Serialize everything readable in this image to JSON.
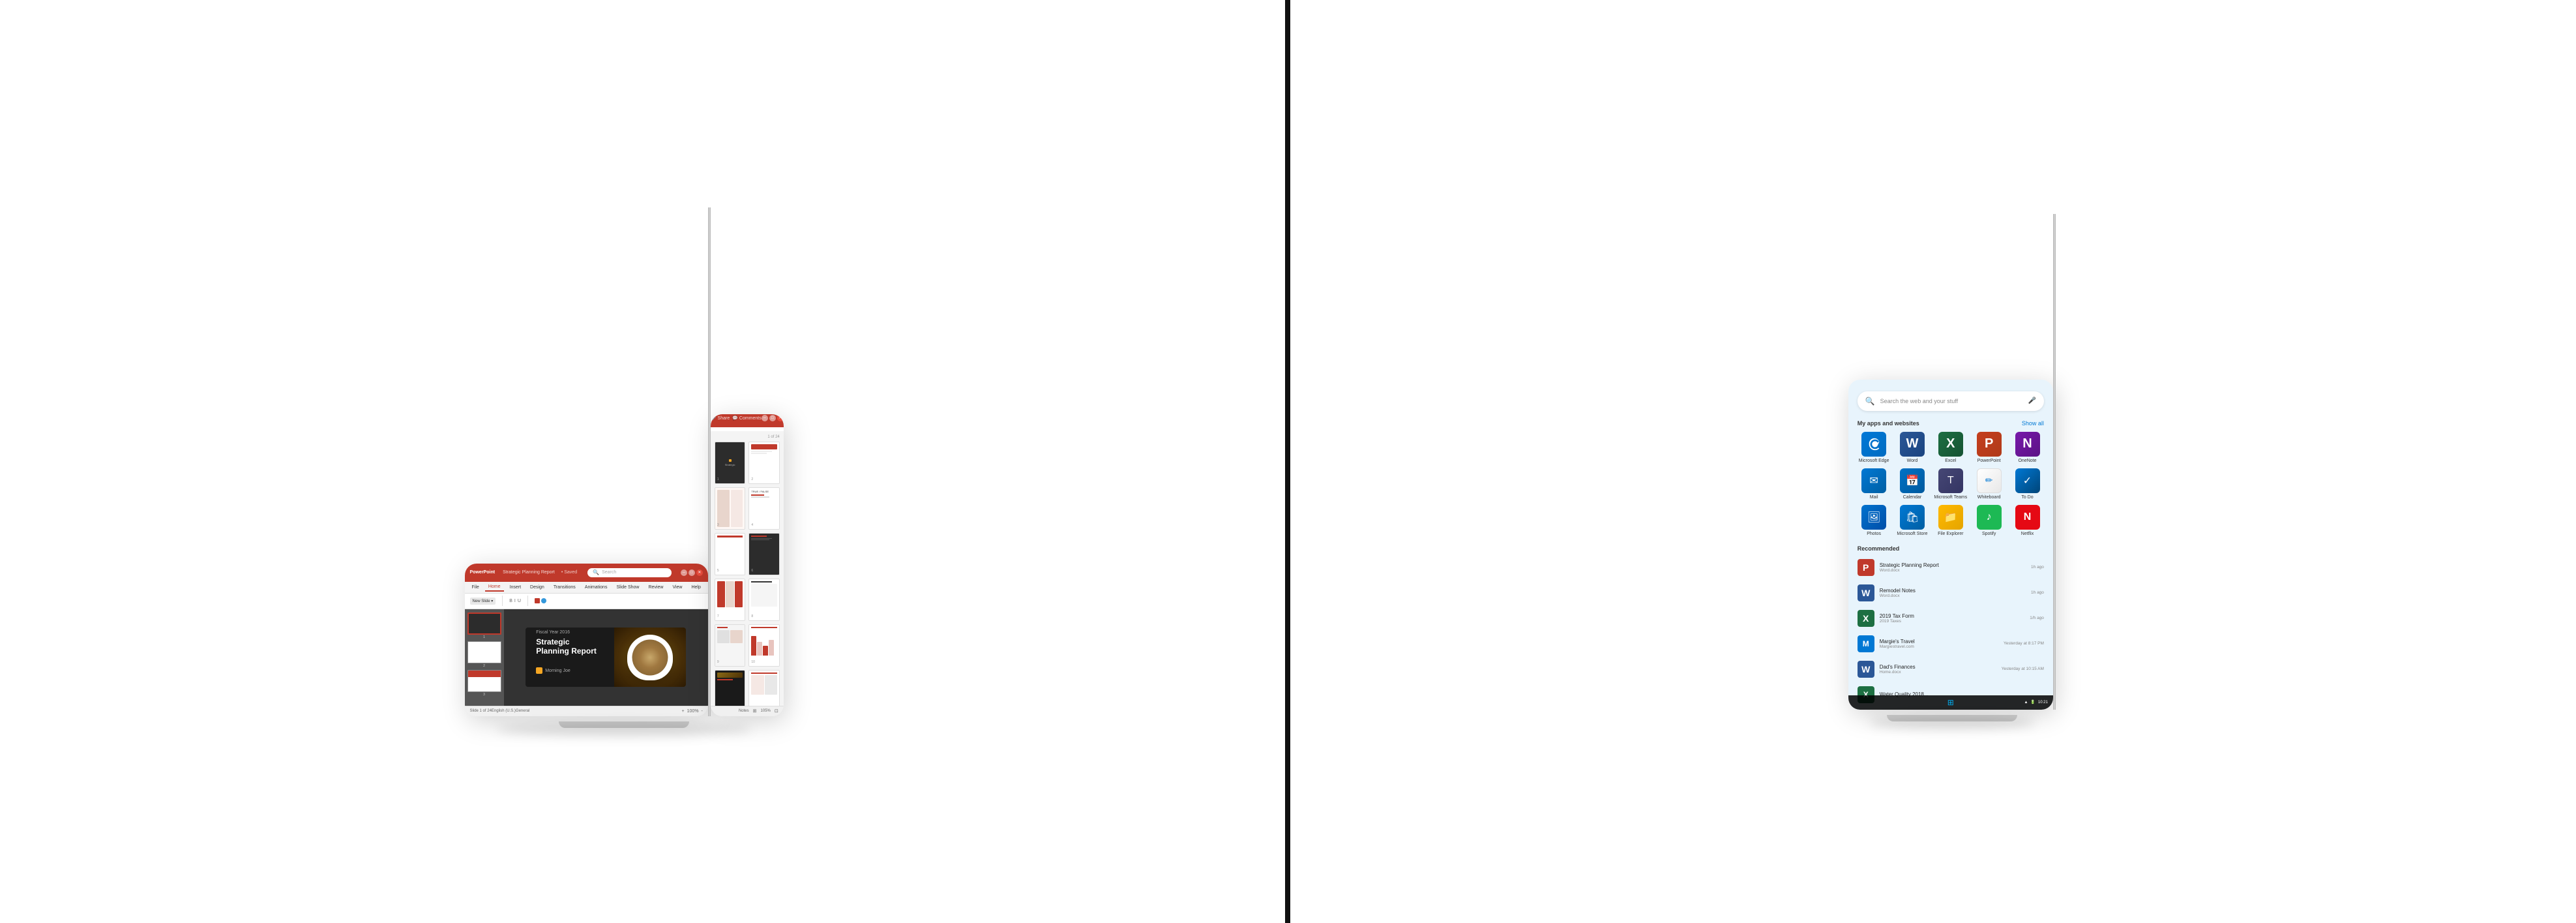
{
  "layout": {
    "background": "#ffffff"
  },
  "device1": {
    "type": "dual-screen-powerpoint",
    "screen_left": {
      "titlebar": {
        "app_name": "PowerPoint",
        "file_name": "Strategic Planning Report",
        "saved_label": "Saved",
        "search_placeholder": "Search"
      },
      "toolbar_tabs": [
        "File",
        "Home",
        "Insert",
        "Design",
        "Transitions",
        "Animations",
        "Slide Show",
        "Review",
        "View",
        "Help"
      ],
      "active_tab": "Home",
      "slide": {
        "year": "Fiscal Year 2016",
        "title": "Strategic Planning Report",
        "company": "Morning Joe"
      },
      "statusbar": {
        "slide_info": "Slide 1 of 24",
        "language": "English (U.S.)",
        "notes": "General"
      }
    },
    "screen_right": {
      "slides_panel": {
        "total_slides": 24,
        "thumbnails_shown": 12
      }
    }
  },
  "device2": {
    "type": "dual-screen-windows",
    "screen_left": {
      "search": {
        "placeholder": "Search the web and your stuff"
      },
      "apps_section": {
        "title": "My apps and websites",
        "show_all_label": "Show all",
        "apps": [
          {
            "name": "Microsoft Edge",
            "icon_type": "edge"
          },
          {
            "name": "Word",
            "icon_type": "word"
          },
          {
            "name": "Excel",
            "icon_type": "excel"
          },
          {
            "name": "PowerPoint",
            "icon_type": "powerpoint"
          },
          {
            "name": "OneNote",
            "icon_type": "onenote"
          },
          {
            "name": "Mail",
            "icon_type": "mail"
          },
          {
            "name": "Calendar",
            "icon_type": "calendar"
          },
          {
            "name": "Microsoft Teams",
            "icon_type": "teams"
          },
          {
            "name": "Whiteboard",
            "icon_type": "whiteboard"
          },
          {
            "name": "To Do",
            "icon_type": "todo"
          },
          {
            "name": "Photos",
            "icon_type": "photos"
          },
          {
            "name": "Microsoft Store",
            "icon_type": "store"
          },
          {
            "name": "File Explorer",
            "icon_type": "explorer"
          },
          {
            "name": "Spotify",
            "icon_type": "spotify"
          },
          {
            "name": "Netflix",
            "icon_type": "netflix"
          }
        ]
      },
      "recommended_section": {
        "title": "Recommended",
        "items": [
          {
            "name": "Strategic Planning Report",
            "sub": "Word.docx",
            "time": "1h ago",
            "icon_type": "powerpoint"
          },
          {
            "name": "Remodel Notes",
            "sub": "Word.docx",
            "time": "1h ago",
            "icon_type": "word"
          },
          {
            "name": "2019 Tax Form",
            "sub": "2019 Taxes",
            "time": "1/h ago",
            "icon_type": "excel"
          },
          {
            "name": "Margie's Travel",
            "sub": "Margiestravel.com",
            "time": "Yesterday at 8:17 PM",
            "icon_type": "edge"
          },
          {
            "name": "Dad's Finances",
            "sub": "Home.docx",
            "time": "Yesterday at 10:15 AM",
            "icon_type": "word"
          },
          {
            "name": "Water Quality 2018...",
            "sub": "",
            "time": "",
            "icon_type": "excel"
          }
        ]
      },
      "taskbar": {
        "start_button": "⊞"
      }
    },
    "screen_right": {
      "type": "windows-desktop",
      "background": "blue-gradient"
    }
  }
}
